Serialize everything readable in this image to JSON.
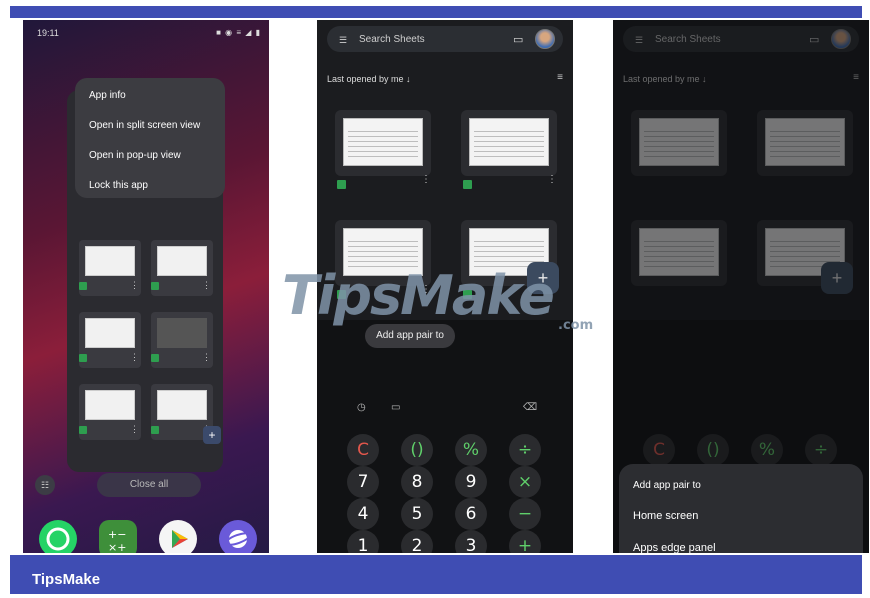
{
  "footer": {
    "brand": "TipsMake"
  },
  "watermark": {
    "main": "TipsMake",
    "suffix": ".com"
  },
  "phone1": {
    "time": "19:11",
    "status_icons": "■ ◉ ≡ ◢ ▮",
    "context_menu": [
      "App info",
      "Open in split screen view",
      "Open in pop-up view",
      "Lock this app"
    ],
    "close_all": "Close all",
    "add_label": "+",
    "grid_label": "☷"
  },
  "phone2": {
    "search_placeholder": "Search Sheets",
    "menu_icon": "☰",
    "folder_icon": "▭",
    "last_opened": "Last opened by me ↓",
    "list_icon": "≡",
    "fab_label": "+",
    "add_app_pair": "Add app pair to",
    "calc_icons": {
      "history": "◷",
      "ruler": "▭",
      "backspace": "⌫"
    },
    "keypad": [
      [
        {
          "label": "C",
          "tone": "red"
        },
        {
          "label": "()",
          "tone": "green"
        },
        {
          "label": "%",
          "tone": "green"
        },
        {
          "label": "÷",
          "tone": "green"
        }
      ],
      [
        {
          "label": "7",
          "tone": ""
        },
        {
          "label": "8",
          "tone": ""
        },
        {
          "label": "9",
          "tone": ""
        },
        {
          "label": "×",
          "tone": "green"
        }
      ],
      [
        {
          "label": "4",
          "tone": ""
        },
        {
          "label": "5",
          "tone": ""
        },
        {
          "label": "6",
          "tone": ""
        },
        {
          "label": "−",
          "tone": "green"
        }
      ],
      [
        {
          "label": "1",
          "tone": ""
        },
        {
          "label": "2",
          "tone": ""
        },
        {
          "label": "3",
          "tone": ""
        },
        {
          "label": "+",
          "tone": "green"
        }
      ]
    ]
  },
  "phone3": {
    "search_placeholder": "Search Sheets",
    "last_opened": "Last opened by me ↓",
    "popup_title": "Add app pair to",
    "popup_items": [
      "Home screen",
      "Apps edge panel"
    ],
    "keypad_top": [
      "C",
      "()",
      "%",
      "÷"
    ]
  },
  "colors": {
    "accent_bar": "#3f4db3",
    "sheets_green": "#2e9e4f",
    "calc_green": "#5fcf6a",
    "calc_red": "#e2574c"
  }
}
